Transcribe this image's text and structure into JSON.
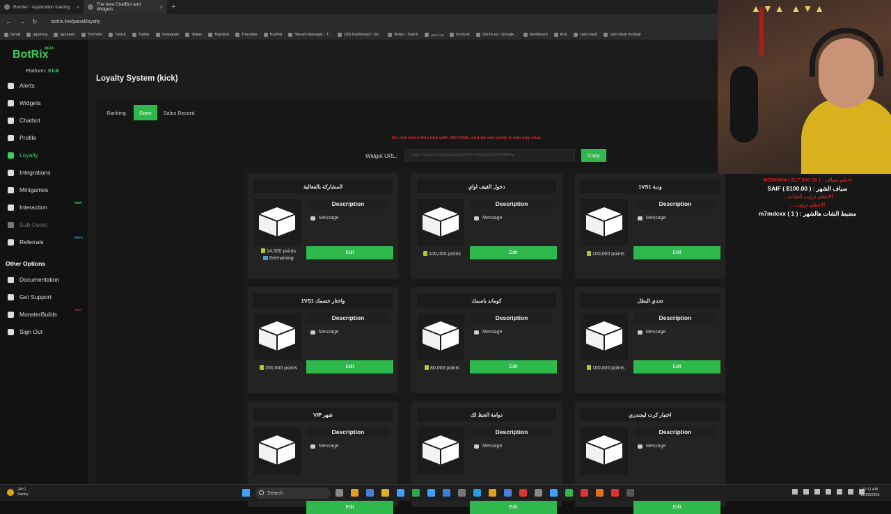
{
  "browser": {
    "tabs": [
      {
        "label": "Render - Application loading",
        "active": false
      },
      {
        "label": "The best ChatBot and Widgets",
        "active": true
      }
    ],
    "url": "botrix.live/panel/loyalty",
    "bookmarks": [
      "Gmail",
      "qgaming",
      "qg14ads",
      "YouTube",
      "Twitch",
      "Twitter",
      "Instagram",
      "dokan",
      "Nightbot",
      "Translate",
      "PayPal",
      "Stream Manager - T...",
      "(28) Dashboard / Str...",
      "Roles - Twitch",
      "ون نيس",
      "tod.tv/ar",
      "QG14 ep - Google...",
      "dashboard",
      "Kick",
      "card clash",
      "card clash football"
    ]
  },
  "sidebar": {
    "logo": "BotRix",
    "logo_badge": "BETA",
    "platform_label": "Platform:",
    "platform_value": "Kick",
    "items": [
      {
        "label": "Alerts",
        "icon": "alert-icon",
        "badge": ""
      },
      {
        "label": "Widgets",
        "icon": "widgets-icon",
        "badge": ""
      },
      {
        "label": "Chatbot",
        "icon": "chat-icon",
        "badge": ""
      },
      {
        "label": "Profile",
        "icon": "profile-icon",
        "badge": ""
      },
      {
        "label": "Loyalty",
        "icon": "loyalty-icon",
        "badge": ""
      },
      {
        "label": "Integrations",
        "icon": "integrations-icon",
        "badge": ""
      },
      {
        "label": "Minigames",
        "icon": "gamepad-icon",
        "badge": ""
      },
      {
        "label": "Interaction",
        "icon": "music-icon",
        "badge": "NEW"
      },
      {
        "label": "Sub-Users",
        "icon": "users-icon",
        "badge": ""
      },
      {
        "label": "Referrals",
        "icon": "referrals-icon",
        "badge": "BETA"
      }
    ],
    "other_heading": "Other Options",
    "other_items": [
      {
        "label": "Documentation",
        "icon": "document-icon",
        "badge": ""
      },
      {
        "label": "Get Support",
        "icon": "support-icon",
        "badge": ""
      },
      {
        "label": "MonsterBuilds",
        "icon": "monitor-icon",
        "badge": "HOT"
      },
      {
        "label": "Sign Out",
        "icon": "sign-out-icon",
        "badge": ""
      }
    ]
  },
  "main": {
    "title": "Loyalty System (kick)",
    "tabs": [
      {
        "label": "Ranking",
        "active": false
      },
      {
        "label": "Store",
        "active": true
      },
      {
        "label": "Sales Record",
        "active": false
      }
    ],
    "warning": "Do not share this link with ANYONE, and do not paste it into any chat.",
    "widget_url_label": "Widget URL:",
    "widget_url_value": "https://botrix.live/widgets/shop?bid=nhhfhqbgnt7LlbsNMbHg",
    "copy_label": "Copy",
    "card_description_label": "Description",
    "card_message_label": "Message",
    "card_edit_label": "Edit",
    "cards": [
      {
        "title": "المشاركة بالفعالية",
        "points": "14,000 points",
        "remaining": "0remaining"
      },
      {
        "title": "دخول القيف اواي",
        "points": "100,000 points",
        "remaining": ""
      },
      {
        "title": "1VS1 ودية",
        "points": "100,000 points",
        "remaining": ""
      },
      {
        "title": "1VS1 واختار خصمك",
        "points": "200,000 points",
        "remaining": ""
      },
      {
        "title": "كوماند باسمك",
        "points": "80,000 points",
        "remaining": ""
      },
      {
        "title": "تحدي البطل",
        "points": "100,000 points",
        "remaining": ""
      },
      {
        "title": "VIP شهر",
        "points": "",
        "remaining": ""
      },
      {
        "title": "دوامة الحظ لك",
        "points": "",
        "remaining": ""
      },
      {
        "title": "اختيار كرت ليجندري",
        "points": "",
        "remaining": ""
      }
    ]
  },
  "stream_overlay": {
    "lines": [
      {
        "text": "MOH0454 ( $17,500.00 ) : اعظم سياف",
        "color": "#d21e1e"
      },
      {
        "text": "SAIF ( $100.00 ) : سياف الشهر",
        "color": "#ffffff"
      },
      {
        "text": "... الاعظم ترتيب الشات",
        "color": "#d21e1e"
      },
      {
        "text": "... الاعظم ترتيب",
        "color": "#d21e1e"
      },
      {
        "text": "m7mdcxx ( 1 ) : مضبط الشات هالشهر",
        "color": "#ffffff"
      }
    ]
  },
  "taskbar": {
    "weather_temp": "24°C",
    "weather_desc": "Sunny",
    "search_placeholder": "Search",
    "time": "12:11 AM",
    "date": "12/30/2025"
  },
  "colors": {
    "accent": "#2fb84b",
    "warning": "#c43030",
    "background": "#1b1b1b"
  }
}
